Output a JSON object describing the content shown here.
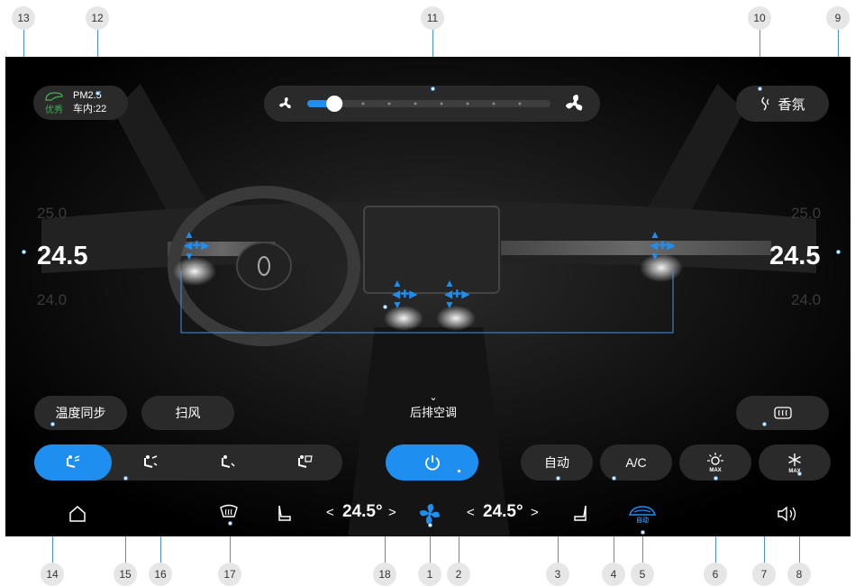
{
  "callouts_top": [
    "13",
    "12",
    "11",
    "10",
    "9"
  ],
  "callouts_bottom": [
    "14",
    "15",
    "16",
    "17",
    "18",
    "1",
    "2",
    "3",
    "4",
    "5",
    "6",
    "7",
    "8"
  ],
  "air_quality": {
    "pm_label": "PM2.5",
    "quality": "优秀",
    "interior_value": "车内:22"
  },
  "fan": {
    "level_fraction": 0.06
  },
  "fragrance": {
    "label": "香氛"
  },
  "driver_temp": {
    "current": "24.5",
    "above": "25.0",
    "below": "24.0"
  },
  "passenger_temp": {
    "current": "24.5",
    "above": "25.0",
    "below": "24.0"
  },
  "buttons": {
    "temp_sync": "温度同步",
    "sweep": "扫风",
    "rear_ac": "后排空调",
    "auto": "自动",
    "ac": "A/C"
  },
  "bottom_bar": {
    "left_temp": "24.5°",
    "right_temp": "24.5°",
    "chevron_left": "<",
    "chevron_right": ">"
  },
  "icons": {
    "power": "power-icon",
    "home": "home-icon",
    "fan": "fan-icon",
    "volume": "volume-icon",
    "seat": "seat-icon",
    "defrost_rear": "rear-defrost-icon",
    "defrost_front": "front-defrost-icon",
    "air_recirc": "air-recirculation-icon",
    "sun_max": "max-heat-icon",
    "snow_max": "max-cool-icon",
    "leaf": "leaf-icon"
  },
  "colors": {
    "accent": "#1e8ef0",
    "pill": "#2a2a2a",
    "leaf": "#3ab54a"
  }
}
